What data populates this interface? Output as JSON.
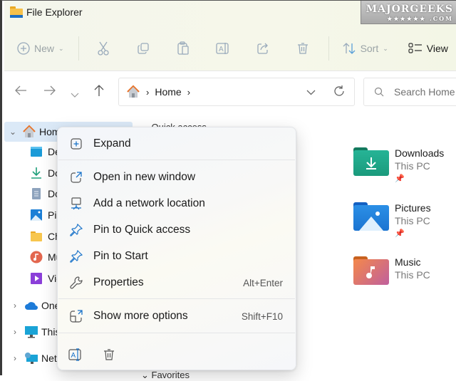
{
  "window": {
    "title": "File Explorer"
  },
  "watermark": {
    "text": "MAJORGEEKS",
    "sub": "★★★★★★ .COM"
  },
  "toolbar": {
    "new_label": "New",
    "sort_label": "Sort",
    "view_label": "View",
    "icons": [
      "new-icon",
      "cut-icon",
      "copy-icon",
      "paste-icon",
      "rename-icon",
      "share-icon",
      "delete-icon",
      "sort-icon",
      "view-icon"
    ]
  },
  "nav": {
    "breadcrumb": [
      {
        "label": "Home"
      }
    ],
    "search_placeholder": "Search Home"
  },
  "sidebar": {
    "items": [
      {
        "label": "Home",
        "icon": "home-icon",
        "expanded": true,
        "selected": true
      },
      {
        "label": "Desktop",
        "visible_label": "De",
        "icon": "desktop-icon"
      },
      {
        "label": "Downloads",
        "visible_label": "Do",
        "icon": "downloads-icon"
      },
      {
        "label": "Documents",
        "visible_label": "Do",
        "icon": "documents-icon"
      },
      {
        "label": "Pictures",
        "visible_label": "Pic",
        "icon": "pictures-icon"
      },
      {
        "label": "Ch",
        "visible_label": "Ch",
        "icon": "folder-icon"
      },
      {
        "label": "Music",
        "visible_label": "Mu",
        "icon": "music-icon"
      },
      {
        "label": "Videos",
        "visible_label": "Vic",
        "icon": "videos-icon"
      },
      {
        "label": "OneDrive",
        "visible_label": "One",
        "icon": "onedrive-icon"
      },
      {
        "label": "This PC",
        "visible_label": "This",
        "icon": "pc-icon"
      },
      {
        "label": "Network",
        "visible_label": "Netv",
        "icon": "network-icon"
      }
    ]
  },
  "main": {
    "quick_access_label": "Quick access",
    "favorites_label": "Favorites",
    "tiles": [
      {
        "name": "Downloads",
        "location": "This PC",
        "pinned": true
      },
      {
        "name": "Pictures",
        "location": "This PC",
        "pinned": true
      },
      {
        "name": "Music",
        "location": "This PC",
        "pinned": false
      }
    ]
  },
  "context_menu": {
    "items": [
      {
        "label": "Expand",
        "icon": "expand-icon",
        "shortcut": ""
      },
      {
        "label": "Open in new window",
        "icon": "open-new-window-icon",
        "shortcut": ""
      },
      {
        "label": "Add a network location",
        "icon": "network-location-icon",
        "shortcut": ""
      },
      {
        "label": "Pin to Quick access",
        "icon": "pin-icon",
        "shortcut": ""
      },
      {
        "label": "Pin to Start",
        "icon": "pin-icon",
        "shortcut": ""
      },
      {
        "label": "Properties",
        "icon": "wrench-icon",
        "shortcut": "Alt+Enter"
      },
      {
        "label": "Show more options",
        "icon": "show-more-icon",
        "shortcut": "Shift+F10"
      }
    ],
    "bottom_icons": [
      "rename-icon",
      "delete-icon"
    ]
  },
  "colors": {
    "accent": "#1a73c9",
    "selection": "#dbe9f7"
  }
}
